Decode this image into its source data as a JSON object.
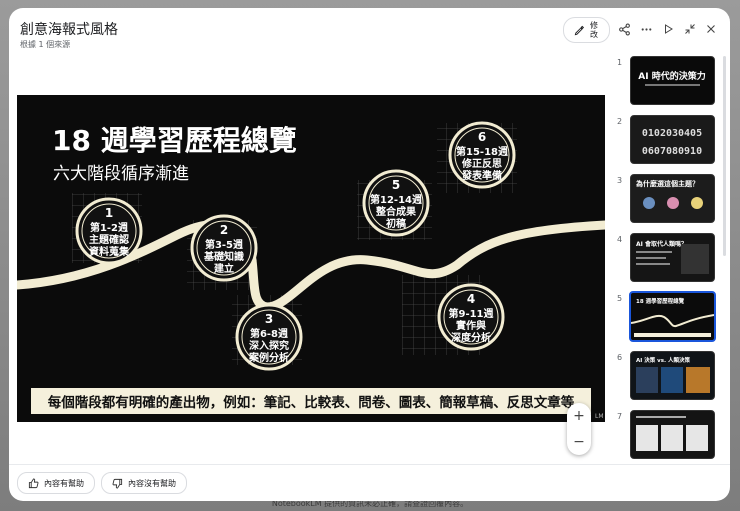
{
  "header": {
    "title": "創意海報式風格",
    "subtitle": "根據 1 個來源",
    "edit_label": "修改"
  },
  "slide": {
    "title": "18 週學習歷程總覽",
    "subtitle": "六大階段循序漸進",
    "stages": [
      {
        "num": "1",
        "lines": [
          "第1-2週",
          "主題確認",
          "資料蒐集"
        ]
      },
      {
        "num": "2",
        "lines": [
          "第3-5週",
          "基礎知識",
          "建立"
        ]
      },
      {
        "num": "3",
        "lines": [
          "第6-8週",
          "深入探究",
          "案例分析"
        ]
      },
      {
        "num": "4",
        "lines": [
          "第9-11週",
          "實作與",
          "深度分析"
        ]
      },
      {
        "num": "5",
        "lines": [
          "第12-14週",
          "整合成果",
          "初稿"
        ]
      },
      {
        "num": "6",
        "lines": [
          "第15-18週",
          "修正反思",
          "發表準備"
        ]
      }
    ],
    "banner": "每個階段都有明確的產出物，例如：筆記、比較表、問卷、圖表、簡報草稿、反思文章等",
    "watermark": "LM"
  },
  "zoom": {
    "in": "+",
    "out": "−"
  },
  "thumbnails": [
    {
      "num": "1",
      "caption": "AI 時代的決策力"
    },
    {
      "num": "2",
      "caption": "0102030405 0607080910"
    },
    {
      "num": "3",
      "caption": "為什麼選這個主題？"
    },
    {
      "num": "4",
      "caption": "AI 會取代人類嗎？"
    },
    {
      "num": "5",
      "caption": "18 週學習歷程總覽"
    },
    {
      "num": "6",
      "caption": "AI 決策 vs. 人類決策"
    },
    {
      "num": "7",
      "caption": ""
    }
  ],
  "feedback": {
    "helpful": "內容有幫助",
    "not_helpful": "內容沒有幫助"
  },
  "footer_note": "NotebookLM 提供的資訊未必正確，請查證回覆內容。",
  "colors": {
    "accent": "#1a56db",
    "slide_bg": "#0b0b0b",
    "path": "#f2ecd2",
    "banner": "#f5f0dc"
  }
}
